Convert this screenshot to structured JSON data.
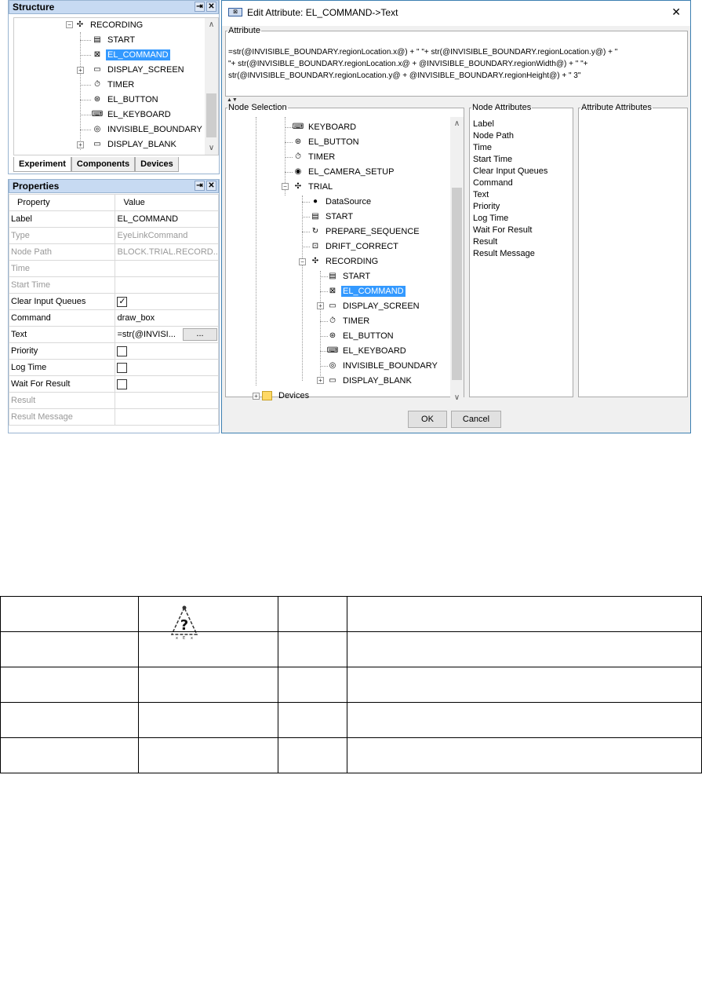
{
  "structure": {
    "title": "Structure",
    "btn_pin": "⇥",
    "btn_close": "✕",
    "nodes": [
      "RECORDING",
      "START",
      "EL_COMMAND",
      "DISPLAY_SCREEN",
      "TIMER",
      "EL_BUTTON",
      "EL_KEYBOARD",
      "INVISIBLE_BOUNDARY",
      "DISPLAY_BLANK"
    ],
    "tabs": [
      "Experiment",
      "Components",
      "Devices"
    ]
  },
  "properties": {
    "title": "Properties",
    "col_property": "Property",
    "col_value": "Value",
    "rows": [
      {
        "name": "Label",
        "value": "EL_COMMAND",
        "disabled": false
      },
      {
        "name": "Type",
        "value": "EyeLinkCommand",
        "disabled": true
      },
      {
        "name": "Node Path",
        "value": "BLOCK.TRIAL.RECORD...",
        "disabled": true
      },
      {
        "name": "Time",
        "value": "",
        "disabled": true
      },
      {
        "name": "Start Time",
        "value": "",
        "disabled": true
      },
      {
        "name": "Clear Input Queues",
        "value": "",
        "checkbox": true,
        "checked": true
      },
      {
        "name": "Command",
        "value": "draw_box",
        "disabled": false
      },
      {
        "name": "Text",
        "value": "=str(@INVISI...",
        "button": "..."
      },
      {
        "name": "Priority",
        "value": "",
        "checkbox": true,
        "checked": false
      },
      {
        "name": "Log Time",
        "value": "",
        "checkbox": true,
        "checked": false
      },
      {
        "name": "Wait For Result",
        "value": "",
        "checkbox": true,
        "checked": false
      },
      {
        "name": "Result",
        "value": "",
        "disabled": true
      },
      {
        "name": "Result Message",
        "value": "",
        "disabled": true
      }
    ]
  },
  "dialog": {
    "title": "Edit Attribute: EL_COMMAND->Text",
    "close": "✕",
    "attribute_legend": "Attribute",
    "attribute_lines": [
      "=str(@INVISIBLE_BOUNDARY.regionLocation.x@) + \" \"+ str(@INVISIBLE_BOUNDARY.regionLocation.y@) + \"",
      "\"+ str(@INVISIBLE_BOUNDARY.regionLocation.x@ + @INVISIBLE_BOUNDARY.regionWidth@) + \" \"+",
      "str(@INVISIBLE_BOUNDARY.regionLocation.y@ + @INVISIBLE_BOUNDARY.regionHeight@) + \"  3\""
    ],
    "node_selection_legend": "Node Selection",
    "node_attributes_legend": "Node Attributes",
    "attribute_attributes_legend": "Attribute Attributes",
    "tree": [
      "KEYBOARD",
      "EL_BUTTON",
      "TIMER",
      "EL_CAMERA_SETUP",
      "TRIAL",
      "DataSource",
      "START",
      "PREPARE_SEQUENCE",
      "DRIFT_CORRECT",
      "RECORDING",
      "START",
      "EL_COMMAND",
      "DISPLAY_SCREEN",
      "TIMER",
      "EL_BUTTON",
      "EL_KEYBOARD",
      "INVISIBLE_BOUNDARY",
      "DISPLAY_BLANK",
      "Devices"
    ],
    "node_attributes": [
      "Label",
      "Node Path",
      "Time",
      "Start Time",
      "Clear Input Queues",
      "Command",
      "Text",
      "Priority",
      "Log Time",
      "Wait For Result",
      "Result",
      "Result Message"
    ],
    "ok": "OK",
    "cancel": "Cancel"
  },
  "doc": {
    "icon": "help-question-icon"
  }
}
